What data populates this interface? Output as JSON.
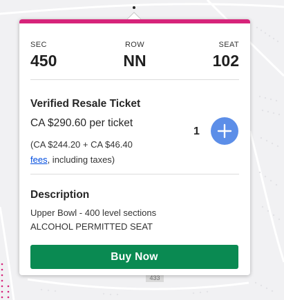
{
  "seat_info": {
    "section": {
      "label": "SEC",
      "value": "450"
    },
    "row": {
      "label": "ROW",
      "value": "NN"
    },
    "seat": {
      "label": "SEAT",
      "value": "102"
    }
  },
  "ticket": {
    "type": "Verified Resale Ticket",
    "price": "CA $290.60",
    "price_suffix": " per ticket",
    "breakdown_prefix": "(CA $244.20 + CA $46.40",
    "fees_link": "fees",
    "breakdown_suffix": ", including taxes)"
  },
  "quantity": {
    "value": "1",
    "add_icon": "plus-icon"
  },
  "description": {
    "title": "Description",
    "lines": [
      "Upper Bowl - 400 level sections",
      "ALCOHOL PERMITTED SEAT"
    ]
  },
  "buy_button": {
    "label": "Buy Now"
  },
  "map": {
    "section_tag": "433"
  },
  "colors": {
    "accent_bar": "#d6237a",
    "buy_button": "#0a8a52",
    "add_button": "#5c8ee8",
    "link": "#024ddf"
  }
}
